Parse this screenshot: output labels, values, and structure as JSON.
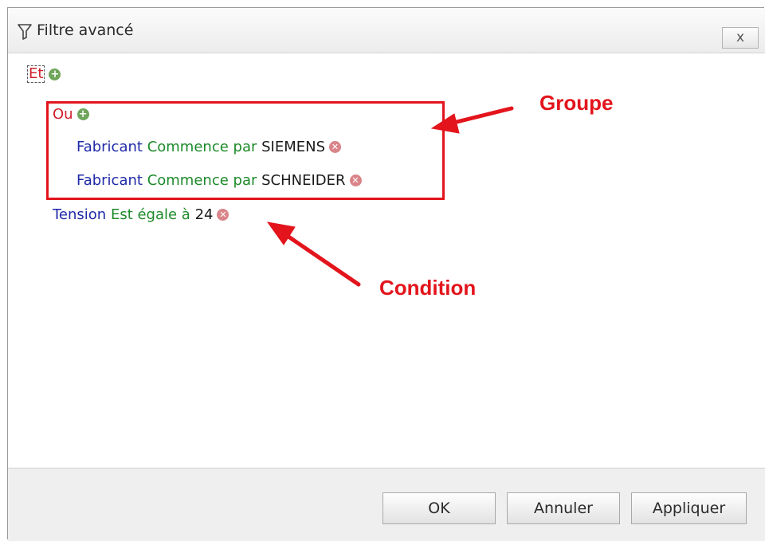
{
  "dialog": {
    "title": "Filtre avancé",
    "close_label": "x"
  },
  "tree": {
    "root_operator": "Et",
    "group": {
      "operator": "Ou",
      "conditions": [
        {
          "field": "Fabricant",
          "operator": "Commence par",
          "value": "SIEMENS"
        },
        {
          "field": "Fabricant",
          "operator": "Commence par",
          "value": "SCHNEIDER"
        }
      ]
    },
    "condition": {
      "field": "Tension",
      "operator": "Est égale à",
      "value": "24"
    }
  },
  "annotations": {
    "group_label": "Groupe",
    "condition_label": "Condition",
    "color": "#e3141c"
  },
  "footer": {
    "ok_label": "OK",
    "cancel_label": "Annuler",
    "apply_label": "Appliquer"
  },
  "icons": {
    "title": "filter-icon",
    "add": "add-icon",
    "remove": "remove-icon"
  }
}
